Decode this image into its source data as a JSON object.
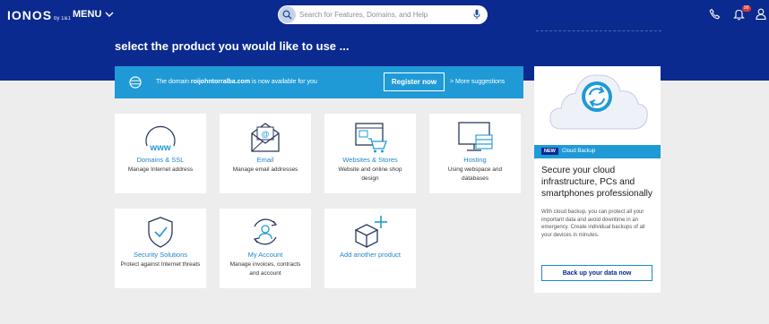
{
  "header": {
    "logo": "IONOS",
    "logo_sub": "by 1&1",
    "menu_label": "MENU",
    "search_placeholder": "Search for Features, Domains, and Help",
    "notification_count": "99",
    "icons": [
      "search-icon",
      "microphone-icon",
      "phone-icon",
      "bell-icon",
      "user-icon",
      "chevron-down-icon"
    ]
  },
  "page_title": "select the product you would like to use ...",
  "domain_banner": {
    "prefix": "The domain",
    "domain": "roijohntorralba.com",
    "suffix": "is now available for you",
    "register_label": "Register now",
    "more_label": "> More suggestions"
  },
  "products": [
    {
      "title": "Domains & SSL",
      "desc": "Manage Internet address",
      "icon": "www-globe-icon"
    },
    {
      "title": "Email",
      "desc": "Manage email addresses",
      "icon": "email-envelope-icon"
    },
    {
      "title": "Websites & Stores",
      "desc": "Website and online shop design",
      "icon": "website-cart-icon"
    },
    {
      "title": "Hosting",
      "desc": "Using webspace and databases",
      "icon": "server-monitor-icon"
    },
    {
      "title": "Security Solutions",
      "desc": "Protect against Internet threats",
      "icon": "shield-check-icon"
    },
    {
      "title": "My Account",
      "desc": "Manage invoices, contracts and account",
      "icon": "account-user-icon"
    },
    {
      "title": "Add another product",
      "desc": "",
      "icon": "add-box-icon"
    }
  ],
  "promo": {
    "new_badge": "NEW",
    "band_label": "Cloud Backup",
    "headline": "Secure your cloud infrastructure, PCs and smartphones professionally",
    "body": "With cloud backup, you can protect all your important data and avoid downtime in an emergency. Create individual backups of all your devices in minutes.",
    "button_label": "Back up your data now",
    "icon": "cloud-sync-icon"
  },
  "colors": {
    "header_bg": "#0b2a8f",
    "accent_blue": "#1f9ad6",
    "link_blue": "#1f86c9",
    "page_bg": "#ededed"
  }
}
